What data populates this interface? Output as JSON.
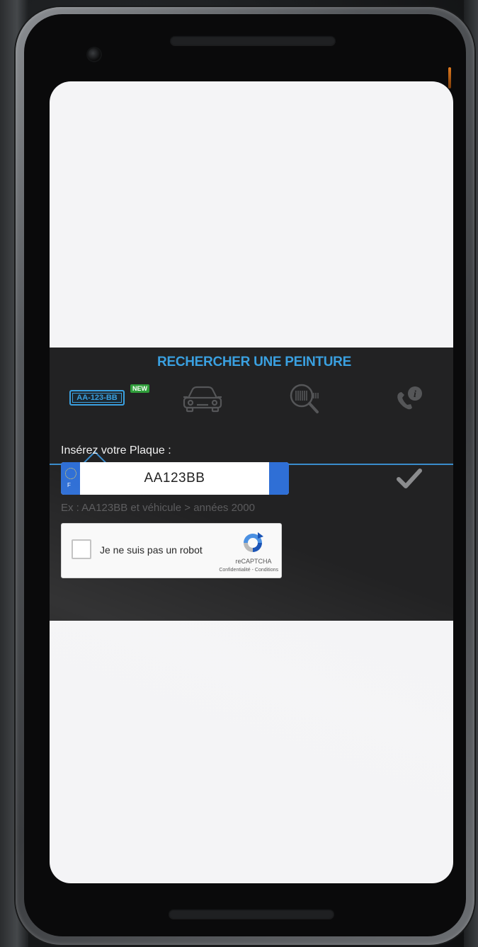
{
  "panel": {
    "title": "RECHERCHER UNE PEINTURE",
    "tabs": [
      {
        "name": "plate",
        "label": "AA-123-BB",
        "badge": "NEW",
        "active": true
      },
      {
        "name": "vehicle",
        "icon": "car-icon"
      },
      {
        "name": "code-search",
        "icon": "barcode-search-icon"
      },
      {
        "name": "contact",
        "icon": "phone-info-icon"
      }
    ],
    "plate_label": "Insérez votre Plaque :",
    "plate_value": "AA123BB",
    "plate_eu_letter": "F",
    "hint": "Ex : AA123BB et véhicule > années 2000",
    "submit_icon": "checkmark-icon"
  },
  "recaptcha": {
    "label": "Je ne suis pas un robot",
    "brand": "reCAPTCHA",
    "privacy": "Confidentialité",
    "separator": " - ",
    "terms": "Conditions"
  },
  "colors": {
    "accent": "#3aa0e0",
    "panel_bg": "#222223",
    "badge": "#2f9e3a",
    "plate_band": "#2f6fd6"
  }
}
